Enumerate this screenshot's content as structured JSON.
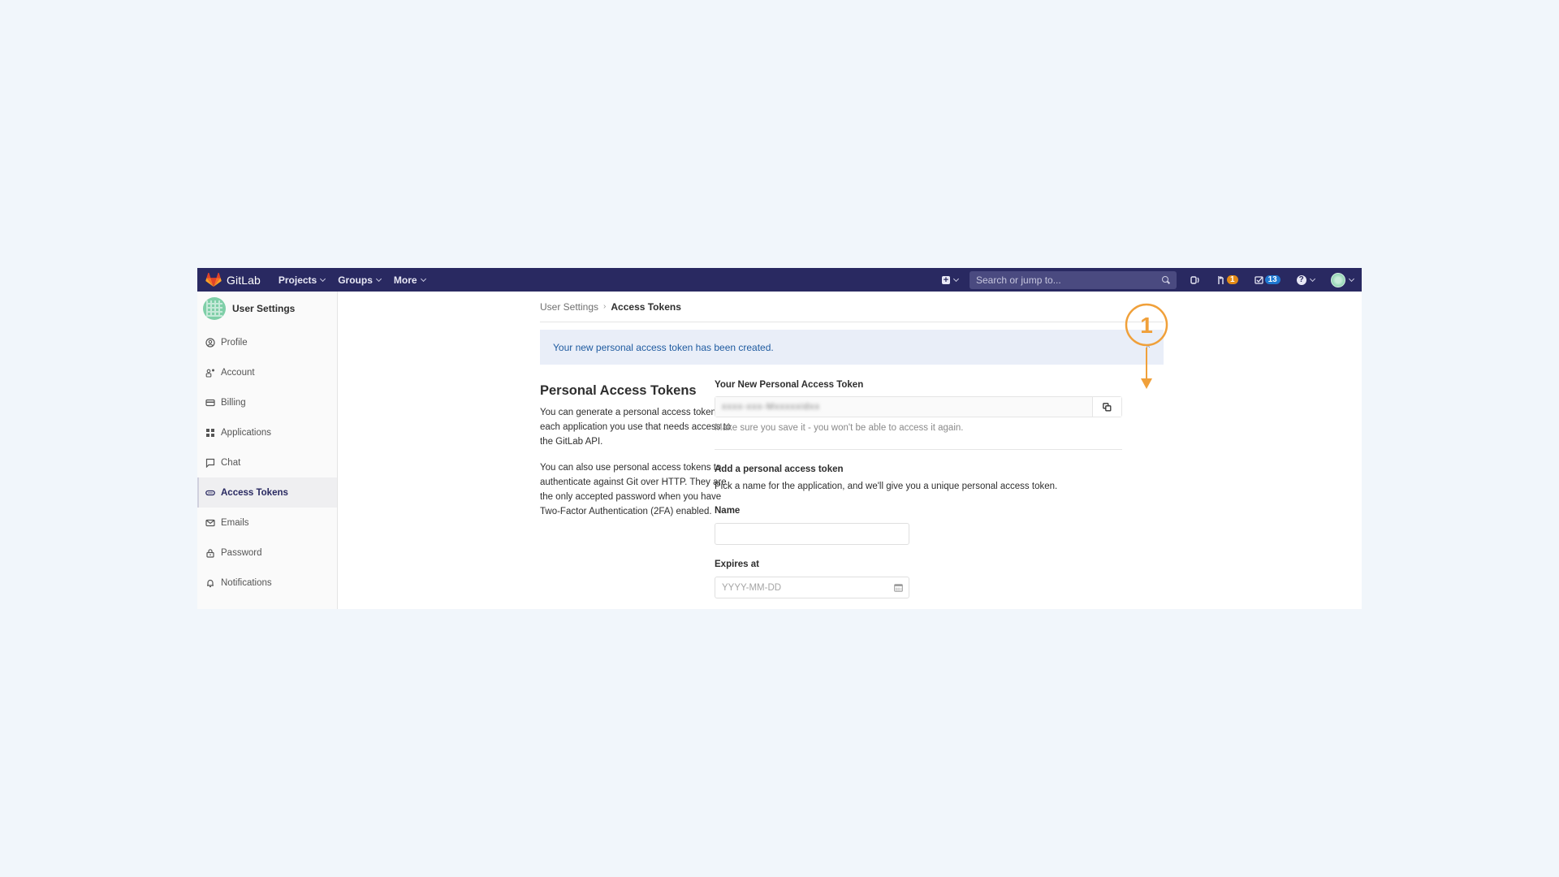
{
  "navbar": {
    "brand": "GitLab",
    "links": [
      {
        "label": "Projects"
      },
      {
        "label": "Groups"
      },
      {
        "label": "More"
      }
    ],
    "search_placeholder": "Search or jump to...",
    "merge_requests_count": "1",
    "todos_count": "13",
    "help_glyph": "?",
    "plus_glyph": "+"
  },
  "sidebar": {
    "title": "User Settings",
    "items": [
      {
        "label": "Profile",
        "icon": "profile-icon"
      },
      {
        "label": "Account",
        "icon": "account-icon"
      },
      {
        "label": "Billing",
        "icon": "billing-icon"
      },
      {
        "label": "Applications",
        "icon": "applications-icon"
      },
      {
        "label": "Chat",
        "icon": "chat-icon"
      },
      {
        "label": "Access Tokens",
        "icon": "token-icon",
        "active": true
      },
      {
        "label": "Emails",
        "icon": "email-icon"
      },
      {
        "label": "Password",
        "icon": "lock-icon"
      },
      {
        "label": "Notifications",
        "icon": "bell-icon"
      }
    ]
  },
  "breadcrumb": {
    "parent": "User Settings",
    "separator": "›",
    "current": "Access Tokens"
  },
  "alert": {
    "message": "Your new personal access token has been created.",
    "close_glyph": "^"
  },
  "intro": {
    "title": "Personal Access Tokens",
    "paragraph1": "You can generate a personal access token for each application you use that needs access to the GitLab API.",
    "paragraph2": "You can also use personal access tokens to authenticate against Git over HTTP. They are the only accepted password when you have Two-Factor Authentication (2FA) enabled."
  },
  "new_token": {
    "label": "Your New Personal Access Token",
    "value_redacted": "xxxx-xxx-Mxxxxxidxx",
    "help": "Make sure you save it - you won't be able to access it again."
  },
  "add_token": {
    "heading": "Add a personal access token",
    "description": "Pick a name for the application, and we'll give you a unique personal access token.",
    "name_label": "Name",
    "name_value": "",
    "expires_label": "Expires at",
    "expires_placeholder": "YYYY-MM-DD"
  },
  "annotation": {
    "number": "1",
    "color": "#f0a03a"
  }
}
